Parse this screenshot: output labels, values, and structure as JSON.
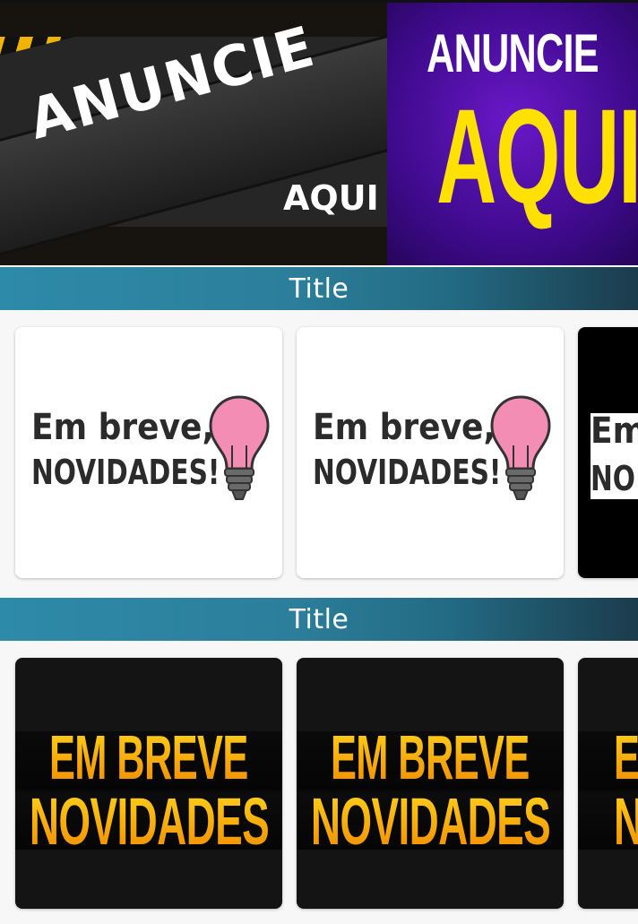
{
  "banner": {
    "ad1": {
      "headline": "ANUNCIE",
      "sub": "AQUI",
      "stripe_color": "#f0b400"
    },
    "ad2": {
      "line1": "ANUNCIE",
      "line2": "AQUI",
      "bg_color": "#4b0fa6",
      "accent_color": "#ffe100"
    }
  },
  "sections": [
    {
      "title": "Title",
      "cards": [
        {
          "line1": "Em breve,",
          "line2": "novidades!",
          "icon": "lightbulb-icon"
        },
        {
          "line1": "Em breve,",
          "line2": "novidades!",
          "icon": "lightbulb-icon"
        },
        {
          "line1": "Em",
          "line2": "NO"
        }
      ]
    },
    {
      "title": "Title",
      "cards": [
        {
          "line1": "EM BREVE",
          "line2": "NOVIDADES"
        },
        {
          "line1": "EM BREVE",
          "line2": "NOVIDADES"
        },
        {
          "line1": "E",
          "line2": "N"
        }
      ]
    }
  ],
  "colors": {
    "header_start": "#2d8aa8",
    "header_end": "#1b3c4c",
    "page_bg": "#f7f7f7"
  }
}
